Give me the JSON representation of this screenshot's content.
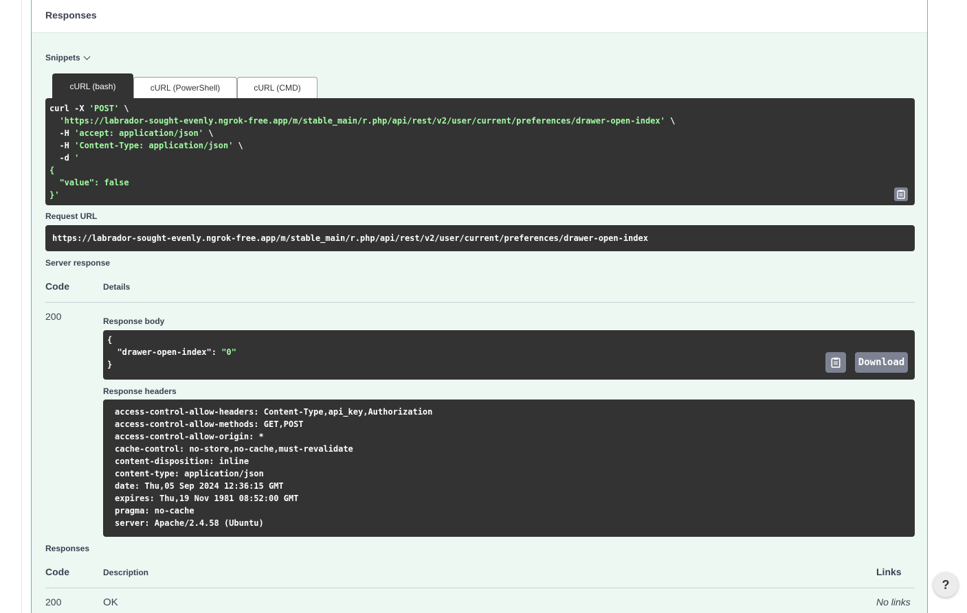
{
  "responses_header": "Responses",
  "snippets": {
    "label": "Snippets"
  },
  "tabs": [
    {
      "label": "cURL (bash)",
      "active": true
    },
    {
      "label": "cURL (PowerShell)",
      "active": false
    },
    {
      "label": "cURL (CMD)",
      "active": false
    }
  ],
  "curl": {
    "line1_cmd": "curl -X ",
    "line1_method": "'POST'",
    "line2_url": "'https://labrador-sought-evenly.ngrok-free.app/m/stable_main/r.php/api/rest/v2/user/current/preferences/drawer-open-index'",
    "line3_header": "'accept: application/json'",
    "line4_header": "'Content-Type: application/json'",
    "line5_data": "'",
    "line6": "{",
    "line7": "  \"value\": false",
    "line8": "}'"
  },
  "request_url": {
    "label": "Request URL",
    "value": "https://labrador-sought-evenly.ngrok-free.app/m/stable_main/r.php/api/rest/v2/user/current/preferences/drawer-open-index"
  },
  "server_response": {
    "label": "Server response",
    "col_code": "Code",
    "col_details": "Details",
    "code": "200",
    "body_label": "Response body",
    "body_key": "\"drawer-open-index\"",
    "body_value": "\"0\"",
    "download_label": "Download",
    "headers_label": "Response headers",
    "headers": [
      "access-control-allow-headers: Content-Type,api_key,Authorization",
      "access-control-allow-methods: GET,POST",
      "access-control-allow-origin: *",
      "cache-control: no-store,no-cache,must-revalidate",
      "content-disposition: inline",
      "content-type: application/json",
      "date: Thu,05 Sep 2024 12:36:15 GMT",
      "expires: Thu,19 Nov 1981 08:52:00 GMT",
      "pragma: no-cache",
      "server: Apache/2.4.58 (Ubuntu)"
    ]
  },
  "responses_table": {
    "label": "Responses",
    "col_code": "Code",
    "col_description": "Description",
    "col_links": "Links",
    "rows": [
      {
        "code": "200",
        "description": "OK",
        "links": "No links"
      }
    ]
  },
  "help": {
    "label": "?"
  },
  "icons": {
    "copy": "clipboard-icon",
    "snippets_toggle": "chevron-down-icon"
  },
  "colors": {
    "success": "#49cc90",
    "code_bg": "#333333",
    "string": "#a2fca2",
    "button_gray": "#7d8293"
  }
}
